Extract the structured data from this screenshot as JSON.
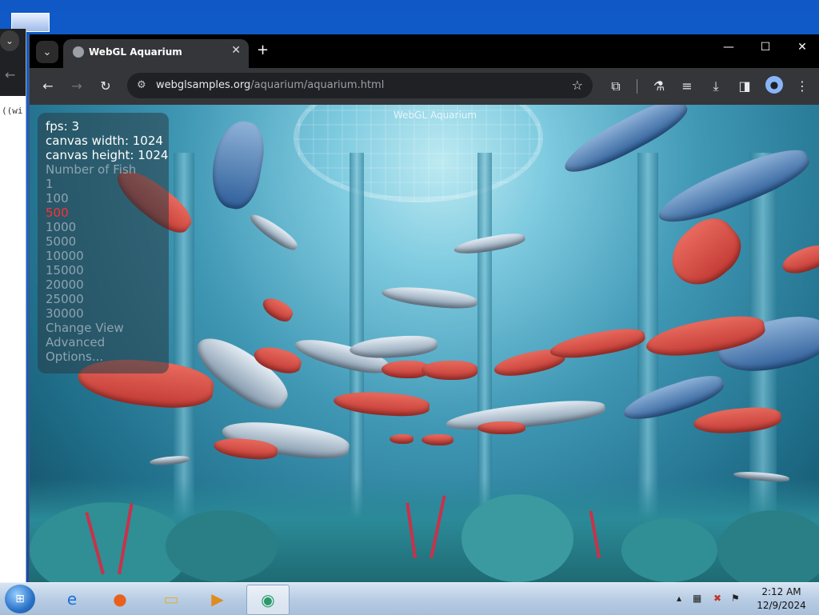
{
  "browser": {
    "tab_title": "WebGL Aquarium",
    "tab_close": "✕",
    "new_tab": "+",
    "url_domain": "webglsamples.org",
    "url_path": "/aquarium/aquarium.html",
    "window_controls": [
      "—",
      "☐",
      "✕"
    ]
  },
  "background_window": {
    "code_snippet": "((wi"
  },
  "page": {
    "overlay_title": "WebGL Aquarium",
    "stats": {
      "fps": "fps: 3",
      "canvas_width": "canvas width: 1024",
      "canvas_height": "canvas height: 1024"
    },
    "options": {
      "number_of_fish_label": "Number of Fish",
      "fish_counts": [
        "1",
        "100",
        "500",
        "1000",
        "5000",
        "10000",
        "15000",
        "20000",
        "25000",
        "30000"
      ],
      "selected_fish_count": "500",
      "change_view": "Change View",
      "advanced": "Advanced",
      "options": "Options..."
    }
  },
  "taskbar": {
    "time": "2:12 AM",
    "date": "12/9/2024"
  },
  "colors": {
    "selected_option": "#ff3030",
    "unselected_option": "#8ea4b0"
  }
}
